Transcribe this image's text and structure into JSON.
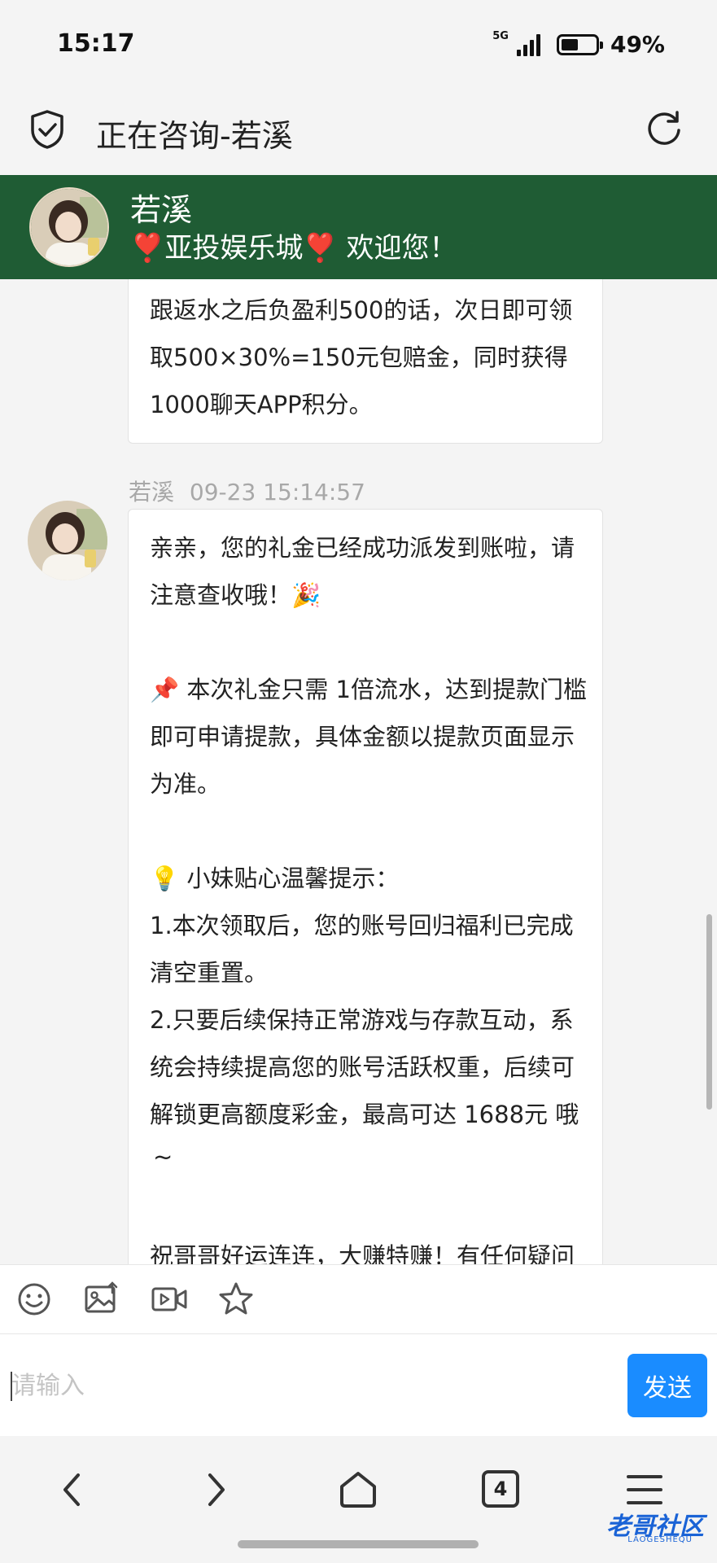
{
  "status_bar": {
    "time": "15:17",
    "network": "5G",
    "battery_percent": "49%",
    "battery_level": 0.49
  },
  "title_bar": {
    "title": "正在咨询-若溪",
    "shield_icon": "shield-check-icon",
    "refresh_icon": "refresh-icon"
  },
  "chat_header": {
    "agent_name": "若溪",
    "slogan": "❣️亚投娱乐城❣️ 欢迎您！",
    "header_color": "#1f5c34"
  },
  "messages": [
    {
      "lines": [
        "跟返水之后负盈利500的话，次日即可领",
        "取500×30%=150元包赔金，同时获得",
        "1000聊天APP积分。"
      ]
    },
    {
      "sender": "若溪",
      "timestamp": "09-23 15:14:57",
      "lines": [
        "亲亲，您的礼金已经成功派发到账啦，请",
        "注意查收哦！🎉",
        "",
        "📌 本次礼金只需 1倍流水，达到提款门槛",
        "即可申请提款，具体金额以提款页面显示",
        "为准。",
        "",
        "💡 小妹贴心温馨提示：",
        "1.本次领取后，您的账号回归福利已完成",
        "清空重置。",
        "2.只要后续保持正常游戏与存款互动，系",
        "统会持续提高您的账号活跃权重，后续可",
        "解锁更高额度彩金，最高可达 1688元 哦",
        "~",
        "",
        "祝哥哥好运连连，大赚特赚！有任何疑问"
      ]
    }
  ],
  "toolbar": {
    "icons": [
      "emoji-icon",
      "image-icon",
      "video-icon",
      "star-icon"
    ]
  },
  "composer": {
    "placeholder": "请输入",
    "send_label": "发送",
    "send_color": "#1a8cff"
  },
  "browser_nav": {
    "tab_count": "4"
  },
  "watermark": {
    "text": "老哥社区",
    "subtext": "LAOGESHEQU"
  }
}
